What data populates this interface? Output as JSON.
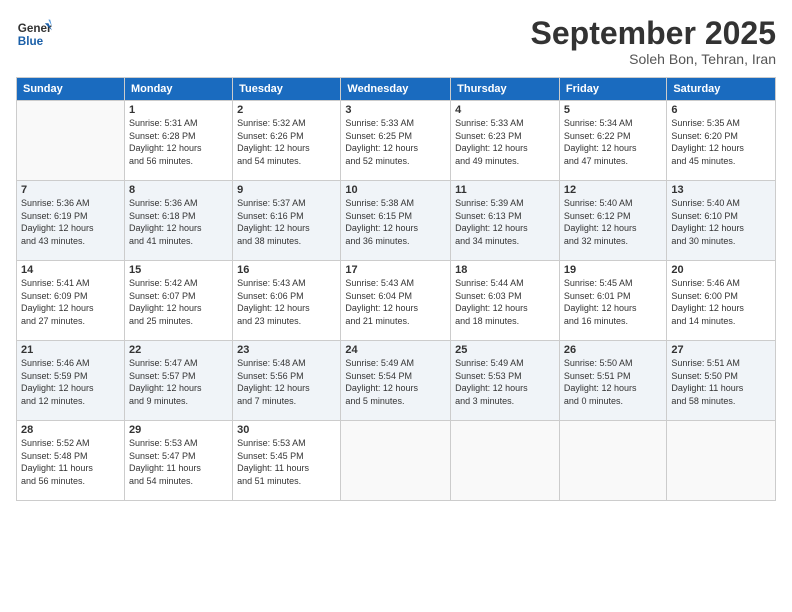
{
  "logo": {
    "line1": "General",
    "line2": "Blue"
  },
  "title": "September 2025",
  "subtitle": "Soleh Bon, Tehran, Iran",
  "weekdays": [
    "Sunday",
    "Monday",
    "Tuesday",
    "Wednesday",
    "Thursday",
    "Friday",
    "Saturday"
  ],
  "weeks": [
    [
      {
        "day": "",
        "info": ""
      },
      {
        "day": "1",
        "info": "Sunrise: 5:31 AM\nSunset: 6:28 PM\nDaylight: 12 hours\nand 56 minutes."
      },
      {
        "day": "2",
        "info": "Sunrise: 5:32 AM\nSunset: 6:26 PM\nDaylight: 12 hours\nand 54 minutes."
      },
      {
        "day": "3",
        "info": "Sunrise: 5:33 AM\nSunset: 6:25 PM\nDaylight: 12 hours\nand 52 minutes."
      },
      {
        "day": "4",
        "info": "Sunrise: 5:33 AM\nSunset: 6:23 PM\nDaylight: 12 hours\nand 49 minutes."
      },
      {
        "day": "5",
        "info": "Sunrise: 5:34 AM\nSunset: 6:22 PM\nDaylight: 12 hours\nand 47 minutes."
      },
      {
        "day": "6",
        "info": "Sunrise: 5:35 AM\nSunset: 6:20 PM\nDaylight: 12 hours\nand 45 minutes."
      }
    ],
    [
      {
        "day": "7",
        "info": "Sunrise: 5:36 AM\nSunset: 6:19 PM\nDaylight: 12 hours\nand 43 minutes."
      },
      {
        "day": "8",
        "info": "Sunrise: 5:36 AM\nSunset: 6:18 PM\nDaylight: 12 hours\nand 41 minutes."
      },
      {
        "day": "9",
        "info": "Sunrise: 5:37 AM\nSunset: 6:16 PM\nDaylight: 12 hours\nand 38 minutes."
      },
      {
        "day": "10",
        "info": "Sunrise: 5:38 AM\nSunset: 6:15 PM\nDaylight: 12 hours\nand 36 minutes."
      },
      {
        "day": "11",
        "info": "Sunrise: 5:39 AM\nSunset: 6:13 PM\nDaylight: 12 hours\nand 34 minutes."
      },
      {
        "day": "12",
        "info": "Sunrise: 5:40 AM\nSunset: 6:12 PM\nDaylight: 12 hours\nand 32 minutes."
      },
      {
        "day": "13",
        "info": "Sunrise: 5:40 AM\nSunset: 6:10 PM\nDaylight: 12 hours\nand 30 minutes."
      }
    ],
    [
      {
        "day": "14",
        "info": "Sunrise: 5:41 AM\nSunset: 6:09 PM\nDaylight: 12 hours\nand 27 minutes."
      },
      {
        "day": "15",
        "info": "Sunrise: 5:42 AM\nSunset: 6:07 PM\nDaylight: 12 hours\nand 25 minutes."
      },
      {
        "day": "16",
        "info": "Sunrise: 5:43 AM\nSunset: 6:06 PM\nDaylight: 12 hours\nand 23 minutes."
      },
      {
        "day": "17",
        "info": "Sunrise: 5:43 AM\nSunset: 6:04 PM\nDaylight: 12 hours\nand 21 minutes."
      },
      {
        "day": "18",
        "info": "Sunrise: 5:44 AM\nSunset: 6:03 PM\nDaylight: 12 hours\nand 18 minutes."
      },
      {
        "day": "19",
        "info": "Sunrise: 5:45 AM\nSunset: 6:01 PM\nDaylight: 12 hours\nand 16 minutes."
      },
      {
        "day": "20",
        "info": "Sunrise: 5:46 AM\nSunset: 6:00 PM\nDaylight: 12 hours\nand 14 minutes."
      }
    ],
    [
      {
        "day": "21",
        "info": "Sunrise: 5:46 AM\nSunset: 5:59 PM\nDaylight: 12 hours\nand 12 minutes."
      },
      {
        "day": "22",
        "info": "Sunrise: 5:47 AM\nSunset: 5:57 PM\nDaylight: 12 hours\nand 9 minutes."
      },
      {
        "day": "23",
        "info": "Sunrise: 5:48 AM\nSunset: 5:56 PM\nDaylight: 12 hours\nand 7 minutes."
      },
      {
        "day": "24",
        "info": "Sunrise: 5:49 AM\nSunset: 5:54 PM\nDaylight: 12 hours\nand 5 minutes."
      },
      {
        "day": "25",
        "info": "Sunrise: 5:49 AM\nSunset: 5:53 PM\nDaylight: 12 hours\nand 3 minutes."
      },
      {
        "day": "26",
        "info": "Sunrise: 5:50 AM\nSunset: 5:51 PM\nDaylight: 12 hours\nand 0 minutes."
      },
      {
        "day": "27",
        "info": "Sunrise: 5:51 AM\nSunset: 5:50 PM\nDaylight: 11 hours\nand 58 minutes."
      }
    ],
    [
      {
        "day": "28",
        "info": "Sunrise: 5:52 AM\nSunset: 5:48 PM\nDaylight: 11 hours\nand 56 minutes."
      },
      {
        "day": "29",
        "info": "Sunrise: 5:53 AM\nSunset: 5:47 PM\nDaylight: 11 hours\nand 54 minutes."
      },
      {
        "day": "30",
        "info": "Sunrise: 5:53 AM\nSunset: 5:45 PM\nDaylight: 11 hours\nand 51 minutes."
      },
      {
        "day": "",
        "info": ""
      },
      {
        "day": "",
        "info": ""
      },
      {
        "day": "",
        "info": ""
      },
      {
        "day": "",
        "info": ""
      }
    ]
  ]
}
